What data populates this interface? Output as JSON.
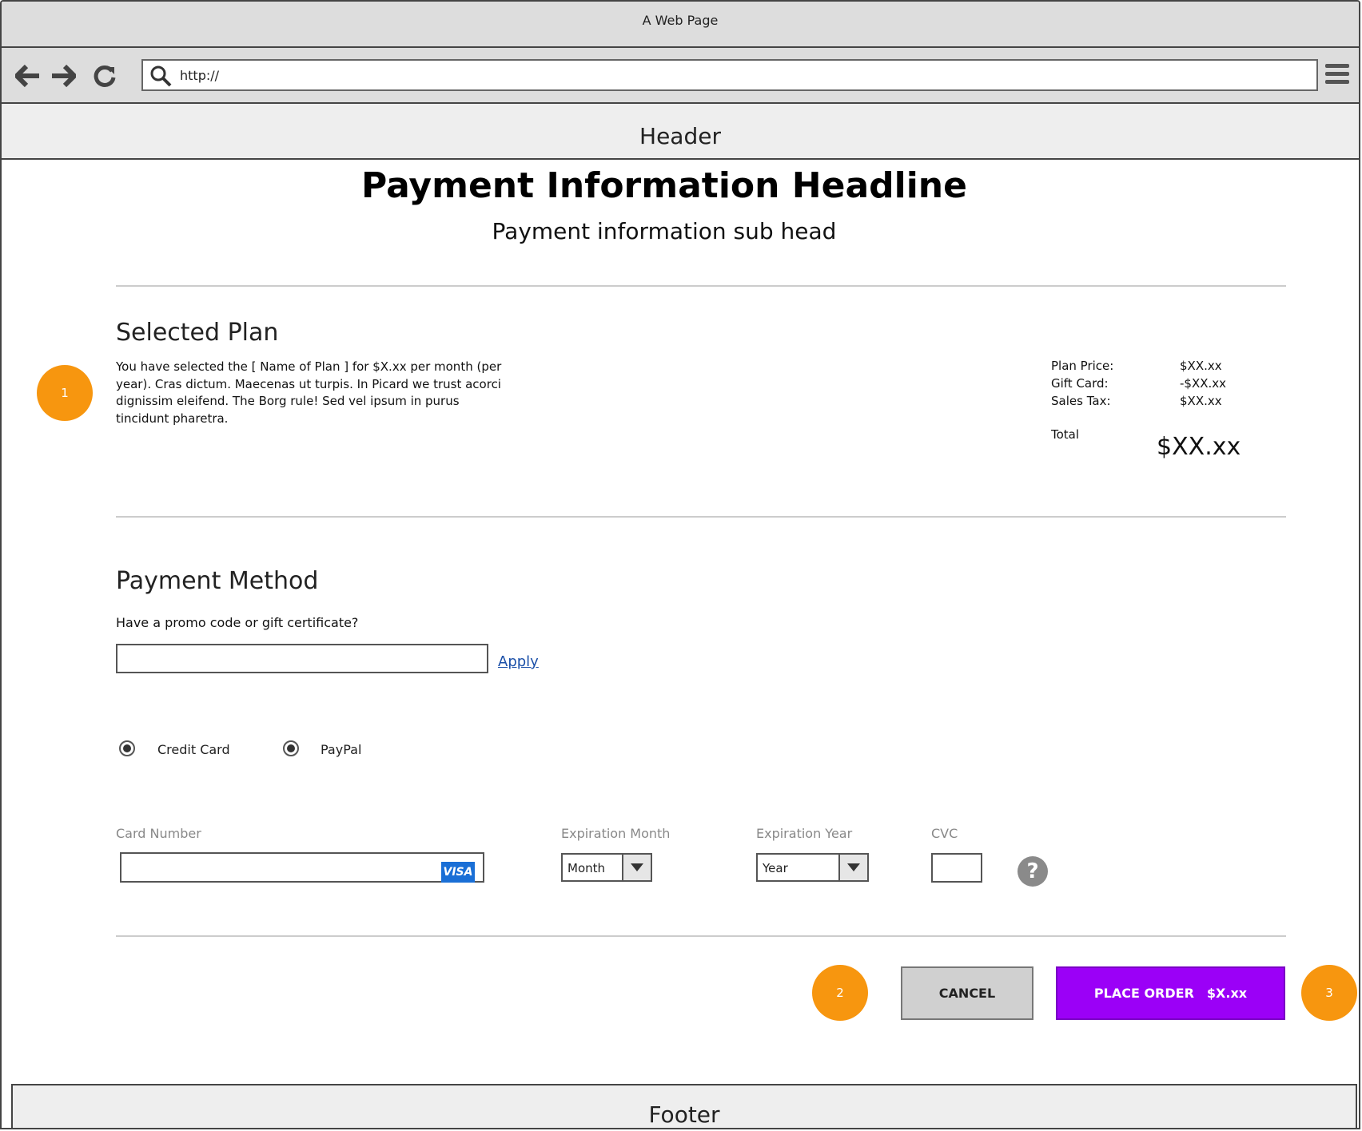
{
  "window": {
    "title": "A Web Page"
  },
  "browser": {
    "url": "http://",
    "back_icon": "back-arrow-icon",
    "forward_icon": "forward-arrow-icon",
    "reload_icon": "reload-icon",
    "menu_icon": "hamburger-menu-icon"
  },
  "header": {
    "label": "Header"
  },
  "page": {
    "headline": "Payment Information Headline",
    "subhead": "Payment information sub head"
  },
  "plan": {
    "title": "Selected Plan",
    "description": "You have selected the [ Name of Plan ] for $X.xx per month (per year). Cras dictum. Maecenas ut turpis. In Picard we trust acorci dignissim eleifend. The Borg rule! Sed vel ipsum in purus tincidunt pharetra.",
    "badge": "1"
  },
  "summary": {
    "plan_price_label": "Plan Price:",
    "plan_price_value": "$XX.xx",
    "gift_card_label": "Gift Card:",
    "gift_card_value": "-$XX.xx",
    "sales_tax_label": "Sales Tax:",
    "sales_tax_value": "$XX.xx",
    "total_label": "Total",
    "total_value": "$XX.xx"
  },
  "payment": {
    "title": "Payment Method",
    "promo_question": "Have a promo code or gift certificate?",
    "apply_label": "Apply",
    "options": [
      {
        "label": "Credit Card",
        "selected": true
      },
      {
        "label": "PayPal",
        "selected": true
      }
    ],
    "card_number_label": "Card Number",
    "card_brand": "VISA",
    "exp_month_label": "Expiration Month",
    "exp_month_value": "Month",
    "exp_year_label": "Expiration Year",
    "exp_year_value": "Year",
    "cvc_label": "CVC",
    "help_glyph": "?"
  },
  "actions": {
    "cancel_label": "CANCEL",
    "place_order_label": "PLACE ORDER",
    "place_order_amount": "$X.xx",
    "badge_cancel": "2",
    "badge_place": "3"
  },
  "footer": {
    "label": "Footer"
  },
  "colors": {
    "accent": "#9b00f7",
    "badge": "#f7960f",
    "link": "#1a4fa8",
    "visa": "#1a6fd6"
  }
}
